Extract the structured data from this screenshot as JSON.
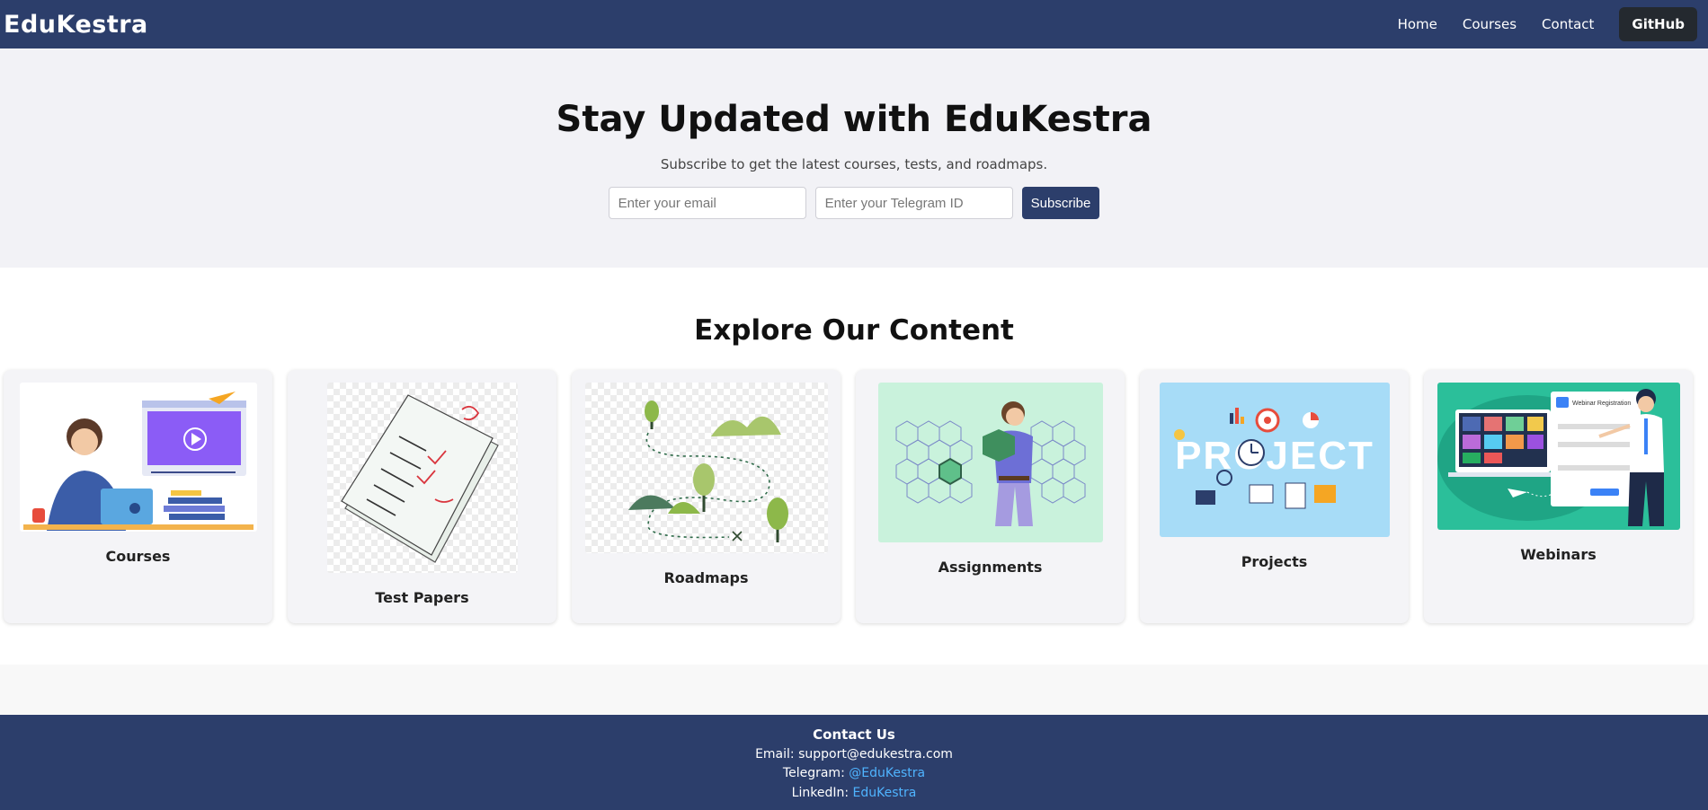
{
  "nav": {
    "brand": "EduKestra",
    "links": [
      "Home",
      "Courses",
      "Contact"
    ],
    "github": "GitHub"
  },
  "hero": {
    "title": "Stay Updated with EduKestra",
    "subtitle": "Subscribe to get the latest courses, tests, and roadmaps.",
    "email_placeholder": "Enter your email",
    "telegram_placeholder": "Enter your Telegram ID",
    "subscribe": "Subscribe"
  },
  "explore": {
    "title": "Explore Our Content",
    "cards": [
      {
        "title": "Courses"
      },
      {
        "title": "Test Papers"
      },
      {
        "title": "Roadmaps"
      },
      {
        "title": "Assignments"
      },
      {
        "title": "Projects"
      },
      {
        "title": "Webinars"
      }
    ]
  },
  "footer": {
    "title": "Contact Us",
    "email_label": "Email: ",
    "email": "support@edukestra.com",
    "telegram_label": "Telegram: ",
    "telegram": "@EduKestra",
    "linkedin_label": "LinkedIn: ",
    "linkedin": "EduKestra"
  },
  "colors": {
    "primary": "#2c3e6b",
    "github": "#24292f",
    "link": "#4fb4ff"
  }
}
